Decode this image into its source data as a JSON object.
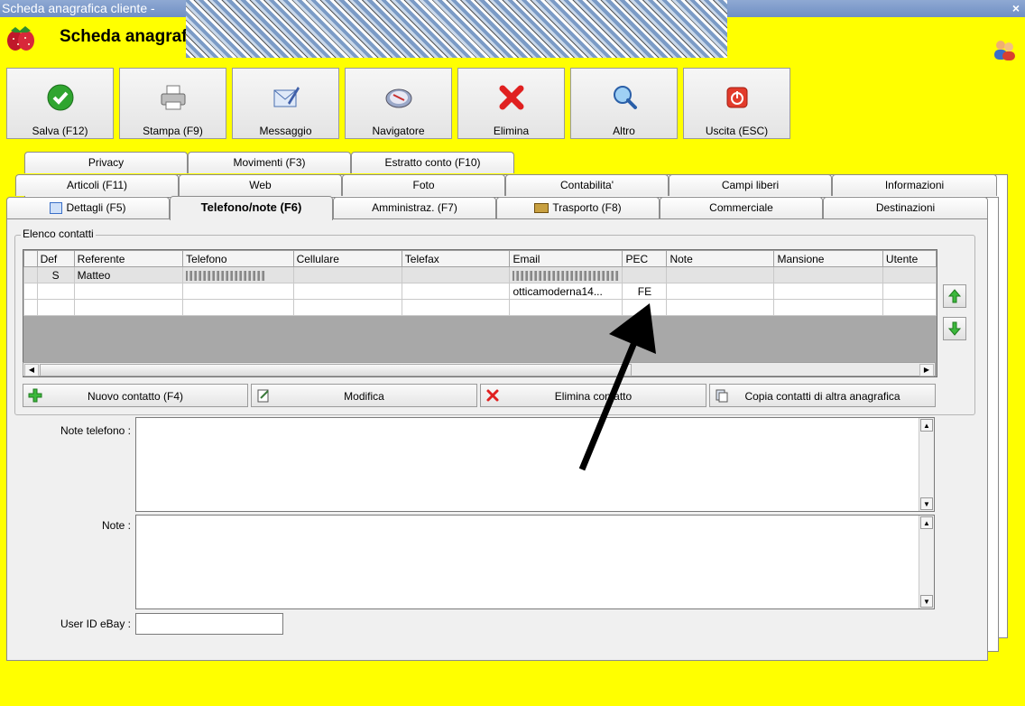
{
  "window": {
    "title": "Scheda anagrafica cliente -",
    "close_glyph": "×"
  },
  "header": {
    "title": "Scheda anagrafica cliente"
  },
  "toolbar": [
    {
      "label": "Salva (F12)",
      "icon": "check-icon"
    },
    {
      "label": "Stampa (F9)",
      "icon": "printer-icon"
    },
    {
      "label": "Messaggio",
      "icon": "message-icon"
    },
    {
      "label": "Navigatore",
      "icon": "compass-icon"
    },
    {
      "label": "Elimina",
      "icon": "delete-icon"
    },
    {
      "label": "Altro",
      "icon": "magnifier-icon"
    },
    {
      "label": "Uscita (ESC)",
      "icon": "power-icon"
    }
  ],
  "tabs": {
    "row1": [
      "Privacy",
      "Movimenti (F3)",
      "Estratto conto (F10)"
    ],
    "row2": [
      "Articoli (F11)",
      "Web",
      "Foto",
      "Contabilita'",
      "Campi liberi",
      "Informazioni"
    ],
    "row3": [
      "Dettagli (F5)",
      "Telefono/note (F6)",
      "Amministraz. (F7)",
      "Trasporto (F8)",
      "Commerciale",
      "Destinazioni"
    ],
    "active": "Telefono/note (F6)"
  },
  "contacts": {
    "legend": "Elenco contatti",
    "columns": [
      "Def",
      "Referente",
      "Telefono",
      "Cellulare",
      "Telefax",
      "Email",
      "PEC",
      "Note",
      "Mansione",
      "Utente"
    ],
    "rows": [
      {
        "def": "S",
        "referente": "Matteo",
        "telefono": "",
        "cellulare": "",
        "telefax": "",
        "email": "",
        "pec": "",
        "note": "",
        "mansione": "",
        "utente": ""
      },
      {
        "def": "",
        "referente": "",
        "telefono": "",
        "cellulare": "",
        "telefax": "",
        "email": "otticamoderna14...",
        "pec": "FE",
        "note": "",
        "mansione": "",
        "utente": ""
      },
      {
        "def": "",
        "referente": "",
        "telefono": "",
        "cellulare": "",
        "telefax": "",
        "email": "",
        "pec": "",
        "note": "",
        "mansione": "",
        "utente": ""
      }
    ],
    "buttons": {
      "new": "Nuovo contatto (F4)",
      "edit": "Modifica",
      "delete": "Elimina contatto",
      "copy": "Copia contatti di altra anagrafica"
    }
  },
  "fields": {
    "note_telefono_label": "Note telefono :",
    "note_label": "Note :",
    "ebay_label": "User ID eBay :",
    "ebay_value": ""
  }
}
